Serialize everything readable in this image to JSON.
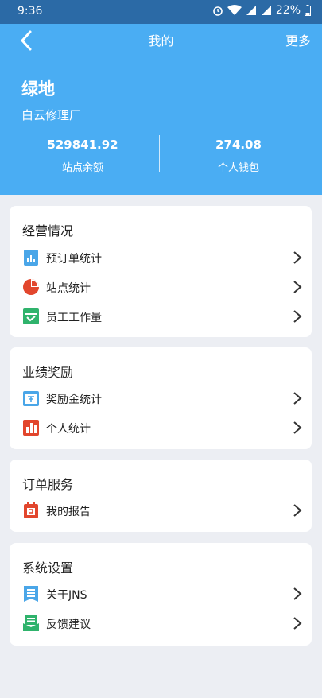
{
  "status_bar": {
    "time": "9:36",
    "battery": "22%"
  },
  "header": {
    "title": "我的",
    "more_label": "更多",
    "station_name": "绿地",
    "station_sub": "白云修理厂",
    "stats": [
      {
        "value": "529841.92",
        "label": "站点余额"
      },
      {
        "value": "274.08",
        "label": "个人钱包"
      }
    ]
  },
  "sections": [
    {
      "title": "经营情况",
      "items": [
        {
          "label": "预订单统计",
          "icon": "bar-chart-doc-icon"
        },
        {
          "label": "站点统计",
          "icon": "pie-chart-icon"
        },
        {
          "label": "员工工作量",
          "icon": "checklist-icon"
        }
      ]
    },
    {
      "title": "业绩奖励",
      "items": [
        {
          "label": "奖励金统计",
          "icon": "reward-calendar-icon"
        },
        {
          "label": "个人统计",
          "icon": "bar-stats-icon"
        }
      ]
    },
    {
      "title": "订单服务",
      "items": [
        {
          "label": "我的报告",
          "icon": "report-icon"
        }
      ]
    },
    {
      "title": "系统设置",
      "items": [
        {
          "label": "关于JNS",
          "icon": "document-icon"
        },
        {
          "label": "反馈建议",
          "icon": "feedback-icon"
        }
      ]
    }
  ],
  "colors": {
    "header": "#4aadf3",
    "status_bar": "#2b6aa6",
    "background": "#eceef3"
  }
}
